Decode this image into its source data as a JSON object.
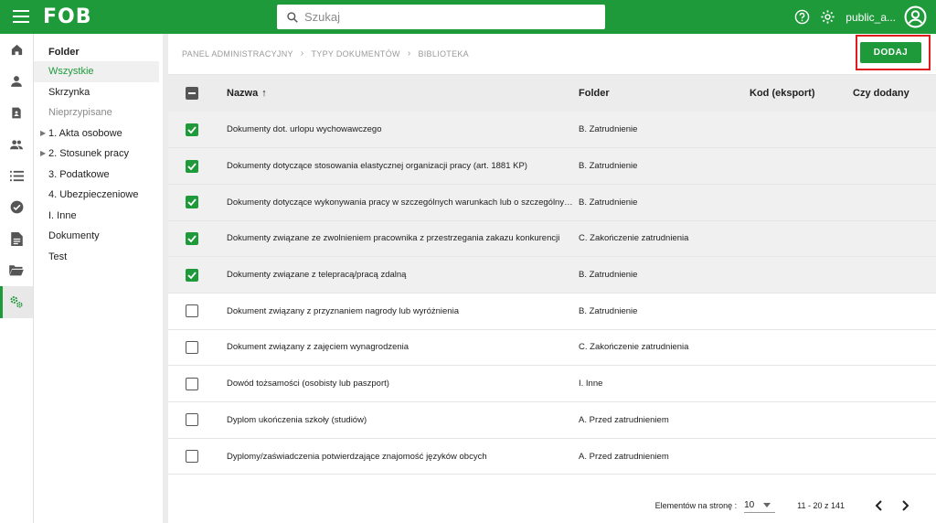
{
  "topbar": {
    "logo": "FOB",
    "search_placeholder": "Szukaj",
    "username": "public_a..."
  },
  "rail": {
    "icons": [
      "home-icon",
      "person-icon",
      "contact-card-icon",
      "people-icon",
      "list-icon",
      "check-circle-icon",
      "document-icon",
      "folder-open-icon",
      "settings-gears-icon"
    ],
    "active_index": 8
  },
  "tree": {
    "title": "Folder",
    "items": [
      {
        "label": "Wszystkie"
      },
      {
        "label": "Skrzynka"
      },
      {
        "label": "Nieprzypisane"
      },
      {
        "label": "1. Akta osobowe"
      },
      {
        "label": "2. Stosunek pracy"
      },
      {
        "label": "3. Podatkowe"
      },
      {
        "label": "4. Ubezpieczeniowe"
      },
      {
        "label": "I. Inne"
      },
      {
        "label": "Dokumenty"
      },
      {
        "label": "Test"
      }
    ]
  },
  "breadcrumb": [
    "PANEL ADMINISTRACYJNY",
    "TYPY DOKUMENTÓW",
    "BIBLIOTEKA"
  ],
  "add_button": "DODAJ",
  "table": {
    "columns": [
      "Nazwa",
      "Folder",
      "Kod (eksport)",
      "Czy dodany"
    ],
    "rows": [
      {
        "checked": true,
        "name": "Dokumenty dot. urlopu wychowawczego",
        "folder": "B. Zatrudnienie"
      },
      {
        "checked": true,
        "name": "Dokumenty dotyczące stosowania elastycznej organizacji pracy (art. 1881 KP)",
        "folder": "B. Zatrudnienie"
      },
      {
        "checked": true,
        "name": "Dokumenty dotyczące wykonywania pracy w szczególnych warunkach lub o szczególnym charakterze",
        "folder": "B. Zatrudnienie"
      },
      {
        "checked": true,
        "name": "Dokumenty związane ze zwolnieniem pracownika z przestrzegania zakazu konkurencji",
        "folder": "C. Zakończenie zatrudnienia"
      },
      {
        "checked": true,
        "name": "Dokumenty związane z telepracą/pracą zdalną",
        "folder": "B. Zatrudnienie"
      },
      {
        "checked": false,
        "name": "Dokument związany z przyznaniem nagrody lub wyróżnienia",
        "folder": "B. Zatrudnienie"
      },
      {
        "checked": false,
        "name": "Dokument związany z zajęciem wynagrodzenia",
        "folder": "C. Zakończenie zatrudnienia"
      },
      {
        "checked": false,
        "name": "Dowód tożsamości (osobisty lub paszport)",
        "folder": "I. Inne"
      },
      {
        "checked": false,
        "name": "Dyplom ukończenia szkoły (studiów)",
        "folder": "A. Przed zatrudnieniem"
      },
      {
        "checked": false,
        "name": "Dyplomy/zaświadczenia potwierdzające znajomość języków obcych",
        "folder": "A. Przed zatrudnieniem"
      }
    ]
  },
  "pagination": {
    "label": "Elementów na stronę :",
    "per_page": "10",
    "range": "11 - 20 z 141"
  },
  "colors": {
    "primary": "#1e9a3a",
    "highlight": "#e01b1b"
  }
}
